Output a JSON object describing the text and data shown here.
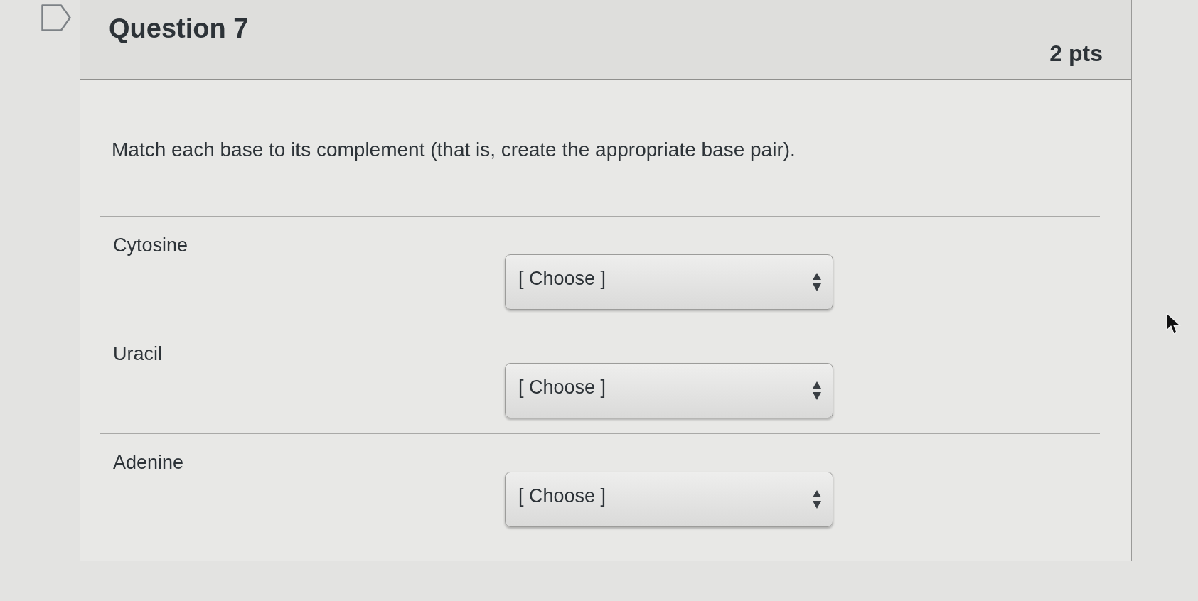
{
  "question": {
    "flagged": false,
    "title": "Question 7",
    "points": "2 pts"
  },
  "prompt": "Match each base to its complement (that is, create the appropriate base pair).",
  "matches": [
    {
      "label": "Cytosine",
      "selected_option": "[ Choose ]"
    },
    {
      "label": "Uracil",
      "selected_option": "[ Choose ]"
    },
    {
      "label": "Adenine",
      "selected_option": "[ Choose ]"
    }
  ]
}
